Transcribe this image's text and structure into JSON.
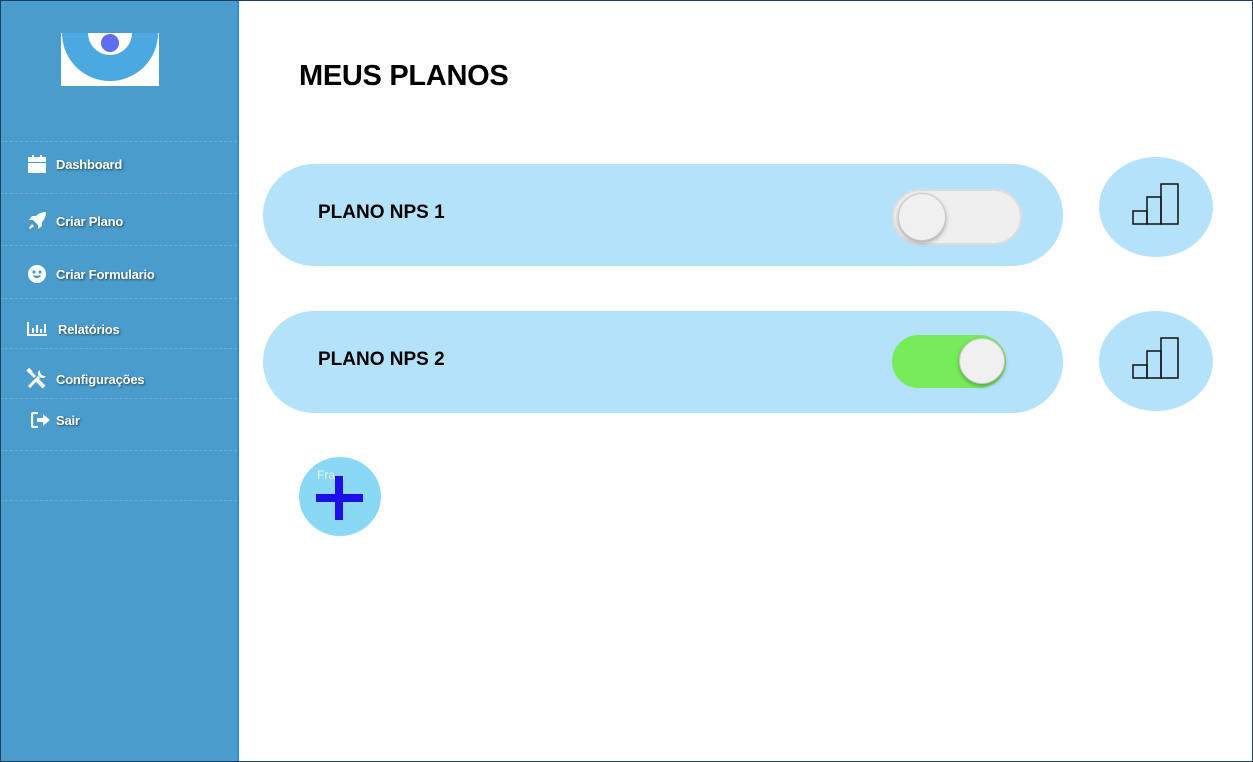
{
  "sidebar": {
    "items": [
      {
        "label": "Dashboard",
        "icon": "calendar-icon"
      },
      {
        "label": "Criar Plano",
        "icon": "rocket-icon"
      },
      {
        "label": "Criar Formulario",
        "icon": "smiley-icon"
      },
      {
        "label": "Relatórios",
        "icon": "bar-chart-icon"
      },
      {
        "label": "Configurações",
        "icon": "tools-icon"
      },
      {
        "label": "Sair",
        "icon": "sign-out-icon"
      }
    ]
  },
  "main": {
    "title": "MEUS PLANOS",
    "plans": [
      {
        "name": "PLANO NPS 1",
        "enabled": false
      },
      {
        "name": "PLANO NPS 2",
        "enabled": true
      }
    ],
    "add_button": {
      "hint": "Fra..."
    }
  },
  "colors": {
    "sidebar_bg": "#4a9ccc",
    "card_bg": "#b3e2fa",
    "toggle_on": "#76ec5a",
    "add_bg": "#89d9f6",
    "plus_color": "#1e0ee8",
    "logo_blue": "#4ba8e0",
    "logo_dot": "#5e6ef2"
  }
}
